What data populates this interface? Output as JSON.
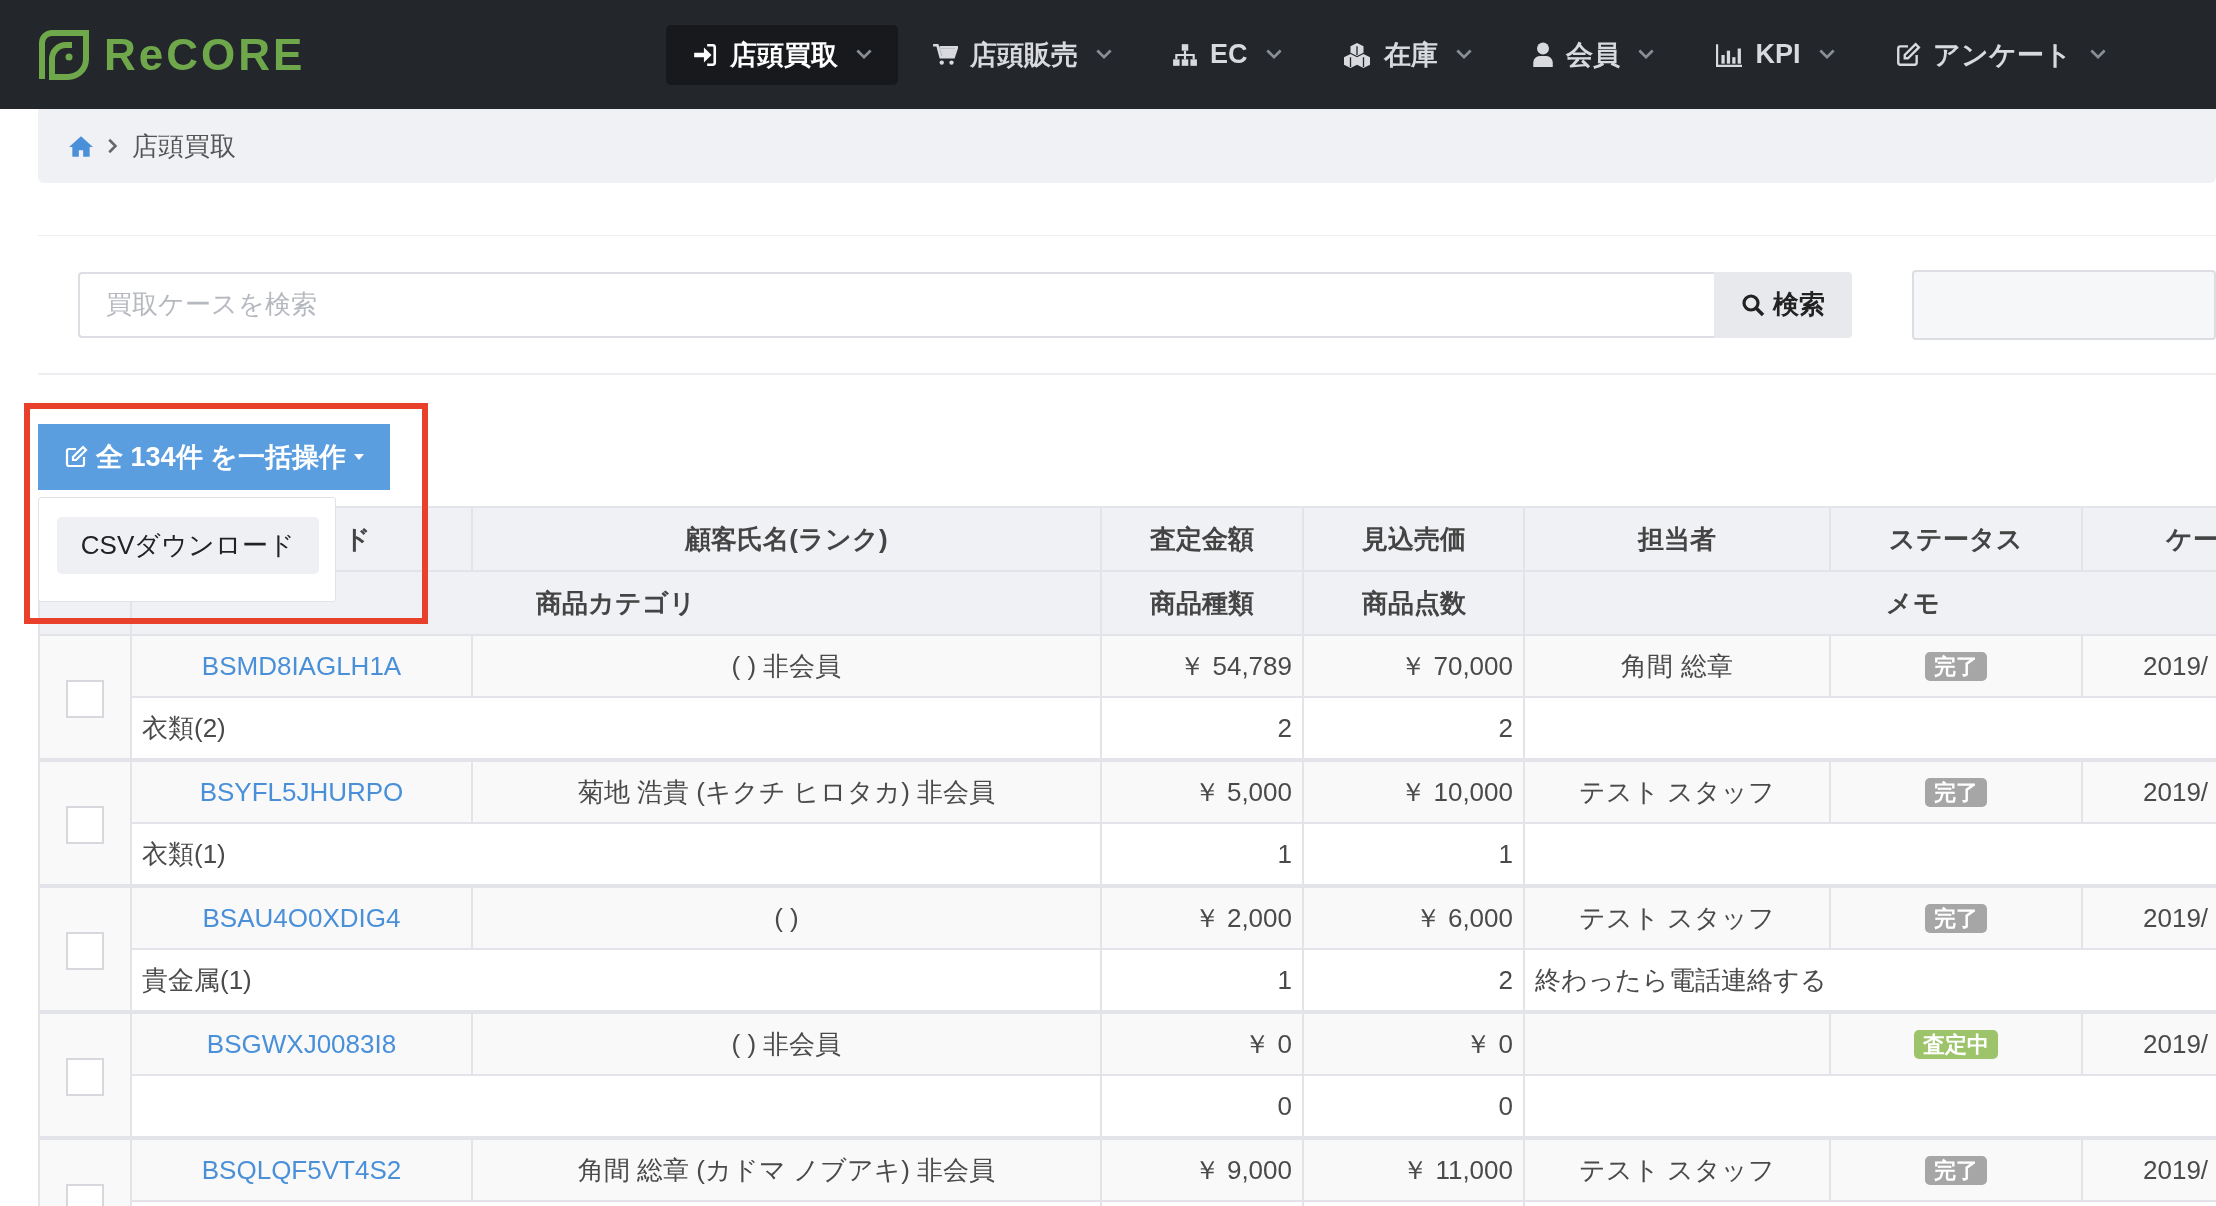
{
  "header": {
    "logo": "ReCORE",
    "nav": [
      {
        "label": "店頭買取",
        "selected": true
      },
      {
        "label": "店頭販売",
        "selected": false
      },
      {
        "label": "EC",
        "selected": false
      },
      {
        "label": "在庫",
        "selected": false
      },
      {
        "label": "会員",
        "selected": false
      },
      {
        "label": "KPI",
        "selected": false
      },
      {
        "label": "アンケート",
        "selected": false
      }
    ]
  },
  "breadcrumb": {
    "current": "店頭買取"
  },
  "search": {
    "placeholder": "買取ケースを検索",
    "button": "検索"
  },
  "bulk_action": {
    "label": "全 134件 を一括操作",
    "menu": [
      "CSVダウンロード"
    ],
    "highlighted": true
  },
  "table": {
    "columns": [
      "ド",
      "顧客氏名(ランク)",
      "査定金額",
      "見込売価",
      "担当者",
      "ステータス",
      "ケー"
    ],
    "subcolumns": [
      "商品カテゴリ",
      "商品種類",
      "商品点数",
      "メモ"
    ],
    "rows": [
      {
        "checked": false,
        "code": "BSMD8IAGLH1A",
        "customer": "( ) 非会員",
        "appraisal": "￥ 54,789",
        "expected": "￥ 70,000",
        "staff": "角間 総章",
        "status": "完了",
        "color": "#a6a6a6",
        "date": "2019/",
        "category": "衣類(2)",
        "kinds": "2",
        "count": "2"
      },
      {
        "checked": false,
        "code": "BSYFL5JHURPO",
        "customer": "菊地 浩貴 (キクチ ヒロタカ) 非会員",
        "appraisal": "￥ 5,000",
        "expected": "￥ 10,000",
        "staff": "テスト スタッフ",
        "status": "完了",
        "color": "#a6a6a6",
        "date": "2019/",
        "category": "衣類(1)",
        "kinds": "1",
        "count": "1"
      },
      {
        "checked": false,
        "code": "BSAU4O0XDIG4",
        "customer": "( )",
        "appraisal": "￥ 2,000",
        "expected": "￥ 6,000",
        "staff": "テスト スタッフ",
        "status": "完了",
        "color": "#a6a6a6",
        "date": "2019/",
        "category": "貴金属(1)",
        "kinds": "1",
        "count": "2",
        "memo": "終わったら電話連絡する"
      },
      {
        "checked": false,
        "code": "BSGWXJ0083I8",
        "customer": "( ) 非会員",
        "appraisal": "￥ 0",
        "expected": "￥ 0",
        "status": "査定中",
        "color": "#9dc46a",
        "date": "2019/",
        "kinds": "0",
        "count": "0"
      },
      {
        "checked": false,
        "code": "BSQLQF5VT4S2",
        "customer": "角間 総章 (カドマ ノブアキ) 非会員",
        "appraisal": "￥ 9,000",
        "expected": "￥ 11,000",
        "staff": "テスト スタッフ",
        "status": "完了",
        "color": "#a6a6a6",
        "date": "2019/"
      }
    ]
  }
}
